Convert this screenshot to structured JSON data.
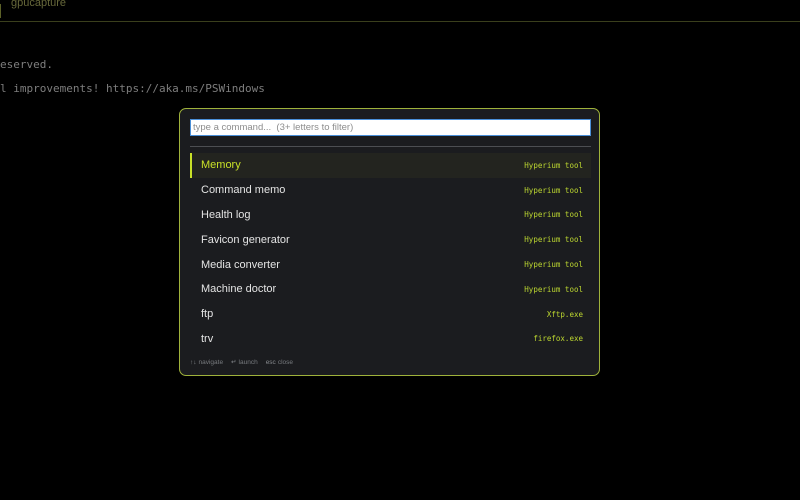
{
  "window": {
    "title": "gpucapture"
  },
  "terminal": {
    "lines": [
      "eserved.",
      "l improvements! https://aka.ms/PSWindows"
    ]
  },
  "launcher": {
    "search": {
      "value": "",
      "placeholder": "type a command...  (3+ letters to filter)"
    },
    "results": [
      {
        "name": "Memory",
        "source": "Hyperium tool",
        "selected": true
      },
      {
        "name": "Command memo",
        "source": "Hyperium tool"
      },
      {
        "name": "Health log",
        "source": "Hyperium tool"
      },
      {
        "name": "Favicon generator",
        "source": "Hyperium tool"
      },
      {
        "name": "Media converter",
        "source": "Hyperium tool"
      },
      {
        "name": "Machine doctor",
        "source": "Hyperium tool"
      },
      {
        "name": "ftp",
        "source": "Xftp.exe"
      },
      {
        "name": "trv",
        "source": "firefox.exe"
      }
    ],
    "footer": {
      "navigate_glyph": "↑↓",
      "navigate_label": "navigate",
      "launch_glyph": "↵",
      "launch_label": "launch",
      "close_glyph": "esc",
      "close_label": "close"
    }
  },
  "colors": {
    "accent": "#c8e028",
    "border": "#9fb23b",
    "panel": "#1b1c1f",
    "background": "#000000"
  }
}
